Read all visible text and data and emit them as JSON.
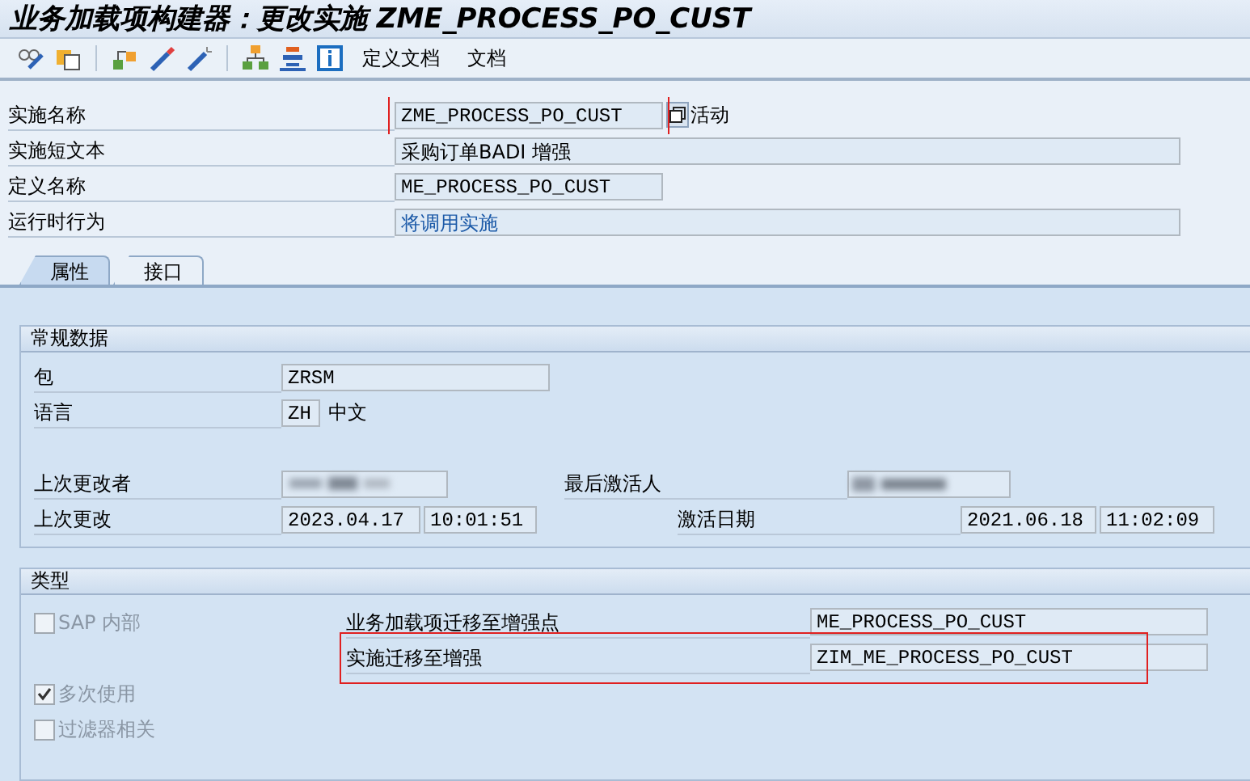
{
  "window": {
    "title": "业务加载项构建器：更改实施 ZME_PROCESS_PO_CUST"
  },
  "toolbar": {
    "icons": [
      {
        "kind": "glasses"
      },
      {
        "kind": "copy"
      },
      {
        "kind": "sep"
      },
      {
        "kind": "hierarchy"
      },
      {
        "kind": "wand"
      },
      {
        "kind": "wand2"
      },
      {
        "kind": "sep"
      },
      {
        "kind": "org"
      },
      {
        "kind": "stack"
      },
      {
        "kind": "info"
      }
    ],
    "buttons": [
      "定义文档",
      "文档"
    ]
  },
  "header": [
    {
      "label": "实施名称",
      "value": "ZME_PROCESS_PO_CUST",
      "kind": "code",
      "highlighted": true,
      "link": false,
      "toggle": {
        "label": "活动",
        "on": false
      }
    },
    {
      "label": "实施短文本",
      "value": "采购订单BADI 增强",
      "kind": "text",
      "highlighted": false,
      "link": false
    },
    {
      "label": "定义名称",
      "value": "ME_PROCESS_PO_CUST",
      "kind": "code",
      "highlighted": false,
      "link": false
    },
    {
      "label": "运行时行为",
      "value": "将调用实施",
      "kind": "text",
      "highlighted": false,
      "link": true
    }
  ],
  "tabs": [
    {
      "label": "属性",
      "selected": true
    },
    {
      "label": "接口",
      "selected": false
    }
  ],
  "general": {
    "title": "常规数据",
    "package": {
      "label": "包",
      "value": "ZRSM"
    },
    "language": {
      "label": "语言",
      "code": "ZH",
      "name": "中文"
    },
    "changed_by": {
      "label": "上次更改者",
      "blurred": true
    },
    "activated_by": {
      "label": "最后激活人",
      "blurred": true
    },
    "changed_on": {
      "label": "上次更改",
      "date": "2023.04.17",
      "time": "10:01:51"
    },
    "activated_on": {
      "label": "激活日期",
      "date": "2021.06.18",
      "time": "11:02:09"
    }
  },
  "type": {
    "title": "类型",
    "checkboxes": [
      {
        "label": "SAP 内部",
        "checked": false,
        "disabled": true
      },
      {
        "label": "多次使用",
        "checked": true,
        "disabled": true
      },
      {
        "label": "过滤器相关",
        "checked": false,
        "disabled": true
      }
    ],
    "fields": [
      {
        "label": "业务加载项迁移至增强点",
        "value": "ME_PROCESS_PO_CUST",
        "highlighted": false
      },
      {
        "label": "实施迁移至增强",
        "value": "ZIM_ME_PROCESS_PO_CUST",
        "highlighted": true
      }
    ]
  }
}
